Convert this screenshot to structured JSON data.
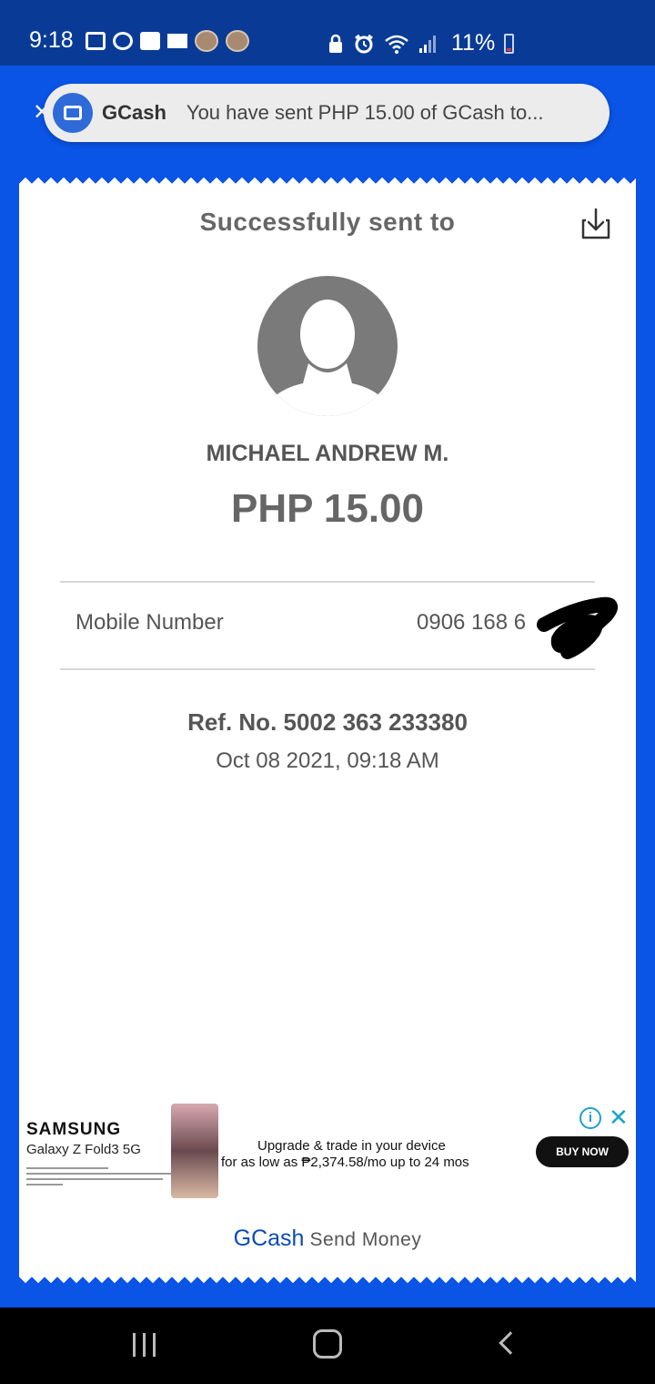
{
  "status_bar": {
    "time": "9:18",
    "battery_percent": "11%",
    "battery_level": 0.11,
    "icons_left": [
      "message-icon",
      "messenger-icon",
      "facebook-icon",
      "mail-icon",
      "avatar-icon",
      "avatar-icon"
    ],
    "icons_right": [
      "lock-icon",
      "alarm-icon",
      "wifi-icon",
      "signal-icon",
      "battery-icon"
    ]
  },
  "notification": {
    "app_name": "GCash",
    "message": "You have sent PHP 15.00 of GCash to...",
    "icon": "message-icon",
    "accent": "#2e6bd8"
  },
  "receipt": {
    "title": "Successfully sent to",
    "recipient_name": "MICHAEL ANDREW M.",
    "amount": "PHP 15.00",
    "details": {
      "mobile_label": "Mobile Number",
      "mobile_value": "0906 168 6"
    },
    "reference": "Ref. No. 5002 363 233380",
    "datetime": "Oct 08 2021, 09:18 AM"
  },
  "ad": {
    "brand": "SAMSUNG",
    "model": "Galaxy Z Fold3 5G",
    "line1": "Upgrade & trade in your device",
    "line2": "for as low as ₱2,374.58/mo up to 24 mos",
    "cta": "BUY NOW"
  },
  "footer": {
    "brand": "GCash",
    "text": "Send Money"
  },
  "colors": {
    "background": "#0a54e6",
    "status_bar": "#093b96",
    "brand_blue": "#0a4bb8",
    "ad_accent": "#1aa3c9"
  }
}
